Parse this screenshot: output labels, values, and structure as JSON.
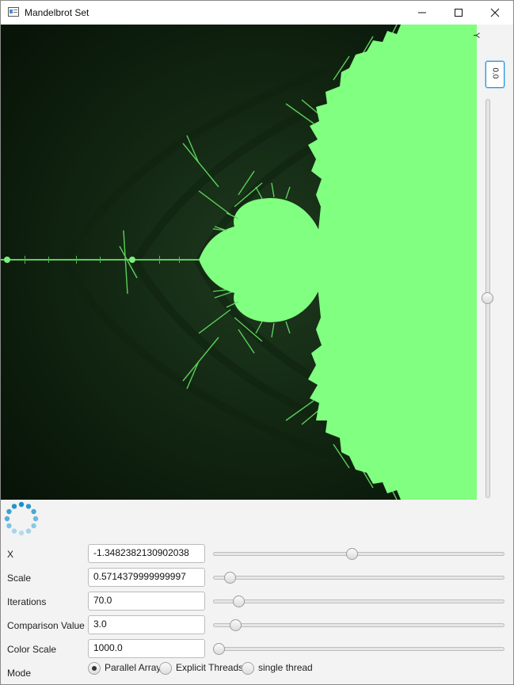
{
  "window": {
    "title": "Mandelbrot Set",
    "controls": [
      "minimize-icon",
      "maximize-icon",
      "close-icon"
    ]
  },
  "colors": {
    "fractal_set": "#80ff80",
    "fractal_edge": "#58c858",
    "fractal_background": "#0a1a0a",
    "accent": "#2b94d3"
  },
  "y_axis": {
    "label": "Y",
    "value": "0.0",
    "slider_level": 0.5
  },
  "controls": {
    "x": {
      "label": "X",
      "value": "-1.3482382130902038",
      "slider_level": 0.48
    },
    "scale": {
      "label": "Scale",
      "value": "0.5714379999999997",
      "slider_level": 0.04
    },
    "iterations": {
      "label": "Iterations",
      "value": "70.0",
      "slider_level": 0.07
    },
    "comparison": {
      "label": "Comparison Value",
      "value": "3.0",
      "slider_level": 0.06
    },
    "color_scale": {
      "label": "Color Scale",
      "value": "1000.0",
      "slider_level": 0.0
    }
  },
  "mode": {
    "label": "Mode",
    "options": [
      {
        "label": "Parallel Array",
        "selected": true
      },
      {
        "label": "Explicit Threads",
        "selected": false
      },
      {
        "label": "single thread",
        "selected": false
      }
    ]
  }
}
